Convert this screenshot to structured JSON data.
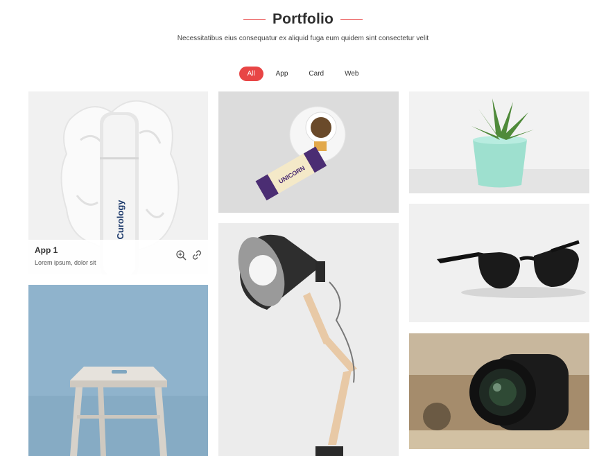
{
  "section": {
    "title": "Portfolio",
    "subtitle": "Necessitatibus eius consequatur ex aliquid fuga eum quidem sint consectetur velit"
  },
  "filters": [
    {
      "label": "All",
      "active": true
    },
    {
      "label": "App",
      "active": false
    },
    {
      "label": "Card",
      "active": false
    },
    {
      "label": "Web",
      "active": false
    }
  ],
  "items": [
    {
      "image": "bottle-product",
      "brand_text": "Curology",
      "caption_title": "App 1",
      "caption_subtitle": "Lorem ipsum, dolor sit"
    },
    {
      "image": "tea-and-crackers",
      "brand_text": "UNICORN"
    },
    {
      "image": "succulent-plant"
    },
    {
      "image": "wooden-stool"
    },
    {
      "image": "desk-lamp"
    },
    {
      "image": "sunglasses"
    },
    {
      "image": "camera-lens"
    }
  ],
  "caption_icons": [
    "zoom-in-icon",
    "link-icon"
  ],
  "colors": {
    "accent": "#e84545",
    "text": "#333333"
  }
}
